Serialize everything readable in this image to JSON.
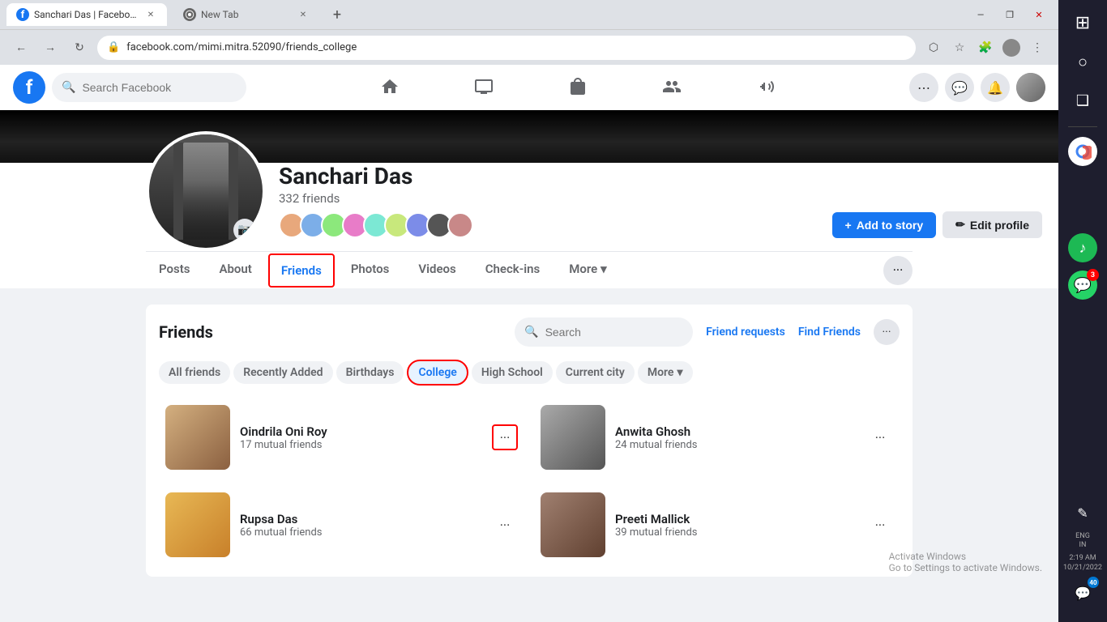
{
  "browser": {
    "tabs": [
      {
        "id": "tab1",
        "title": "Sanchari Das | Facebook",
        "favicon": "fb",
        "active": true,
        "url": "facebook.com/mimi.mitra.52090/friends_college"
      },
      {
        "id": "tab2",
        "title": "New Tab",
        "favicon": "globe",
        "active": false
      }
    ],
    "url": "facebook.com/mimi.mitra.52090/friends_college"
  },
  "header": {
    "logo": "f",
    "search_placeholder": "Search Facebook",
    "nav_items": [
      "home",
      "video",
      "marketplace",
      "groups",
      "gaming"
    ],
    "actions": [
      "apps",
      "messenger",
      "notifications",
      "profile"
    ]
  },
  "profile": {
    "name": "Sanchari Das",
    "friends_count": "332 friends",
    "cover_bg": "#111",
    "add_story_label": "Add to story",
    "edit_profile_label": "Edit profile",
    "nav_items": [
      "Posts",
      "About",
      "Friends",
      "Photos",
      "Videos",
      "Check-ins",
      "More"
    ],
    "active_nav": "Friends"
  },
  "friends": {
    "title": "Friends",
    "search_placeholder": "Search",
    "friend_requests_label": "Friend requests",
    "find_friends_label": "Find Friends",
    "filter_tabs": [
      "All friends",
      "Recently Added",
      "Birthdays",
      "College",
      "High School",
      "Current city",
      "More"
    ],
    "active_filter": "College",
    "cards": [
      {
        "name": "Oindrila Oni Roy",
        "mutual": "17 mutual friends",
        "photo_color": "#c9a87c"
      },
      {
        "name": "Anwita Ghosh",
        "mutual": "24 mutual friends",
        "photo_color": "#888"
      },
      {
        "name": "Rupsa Das",
        "mutual": "66 mutual friends",
        "photo_color": "#d4a044"
      },
      {
        "name": "Preeti Mallick",
        "mutual": "39 mutual friends",
        "photo_color": "#8a7060"
      }
    ]
  },
  "windows_sidebar": {
    "start_icon": "⊞",
    "search_icon": "○",
    "task_view": "❑",
    "chrome_icon": "◉",
    "spotify_icon": "♫",
    "whatsapp_icon": "💬",
    "whatsapp_badge": "3",
    "edge_icon": "e",
    "lang": "ENG",
    "region": "IN",
    "time": "2:19 AM",
    "date": "10/21/2022",
    "notifications_badge": "40",
    "pen_icon": "✎"
  },
  "activate_windows": {
    "line1": "Activate Windows",
    "line2": "Go to Settings to activate Windows."
  }
}
